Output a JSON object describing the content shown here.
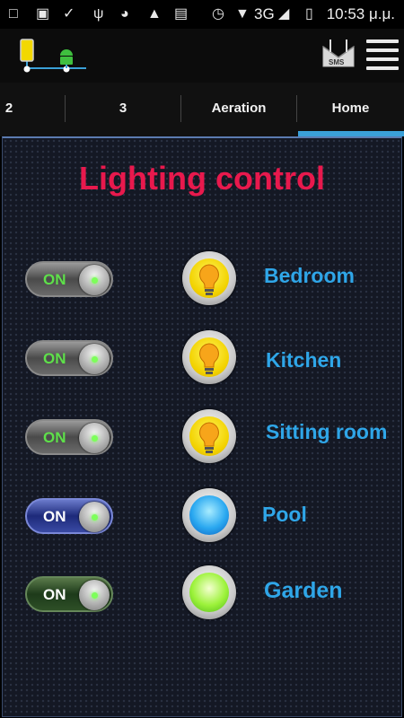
{
  "status_bar": {
    "time": "10:53 μ.μ.",
    "network": "3G",
    "icons": [
      "message-icon",
      "image-icon",
      "check-icon",
      "usb-icon",
      "speed-icon",
      "android-icon",
      "shopping-icon",
      "alarm-icon",
      "wifi-icon",
      "signal-icon",
      "battery-charging-icon"
    ]
  },
  "header": {
    "logo_icon": "phone-to-android-logo",
    "sms_label": "SMS",
    "menu_icon": "hamburger-menu-icon"
  },
  "tabs": [
    {
      "label": "2"
    },
    {
      "label": "3"
    },
    {
      "label": "Aeration"
    },
    {
      "label": "Home",
      "selected": true
    }
  ],
  "main": {
    "title": "Lighting control",
    "rows": [
      {
        "toggle_label": "ON",
        "toggle_style": "gray",
        "indicator": "yellow",
        "indicator_icon": "lightbulb-icon",
        "label": "Bedroom"
      },
      {
        "toggle_label": "ON",
        "toggle_style": "gray",
        "indicator": "yellow",
        "indicator_icon": "lightbulb-icon",
        "label": "Kitchen"
      },
      {
        "toggle_label": "ON",
        "toggle_style": "gray",
        "indicator": "yellow",
        "indicator_icon": "lightbulb-icon",
        "label": "Sitting room"
      },
      {
        "toggle_label": "ON",
        "toggle_style": "blue",
        "indicator": "blue",
        "label": "Pool"
      },
      {
        "toggle_label": "ON",
        "toggle_style": "green",
        "indicator": "green",
        "label": "Garden"
      }
    ]
  },
  "colors": {
    "title": "#e8194d",
    "label": "#2fa6e8",
    "accent": "#3aa0d8",
    "on_text": "#5ee04a"
  }
}
